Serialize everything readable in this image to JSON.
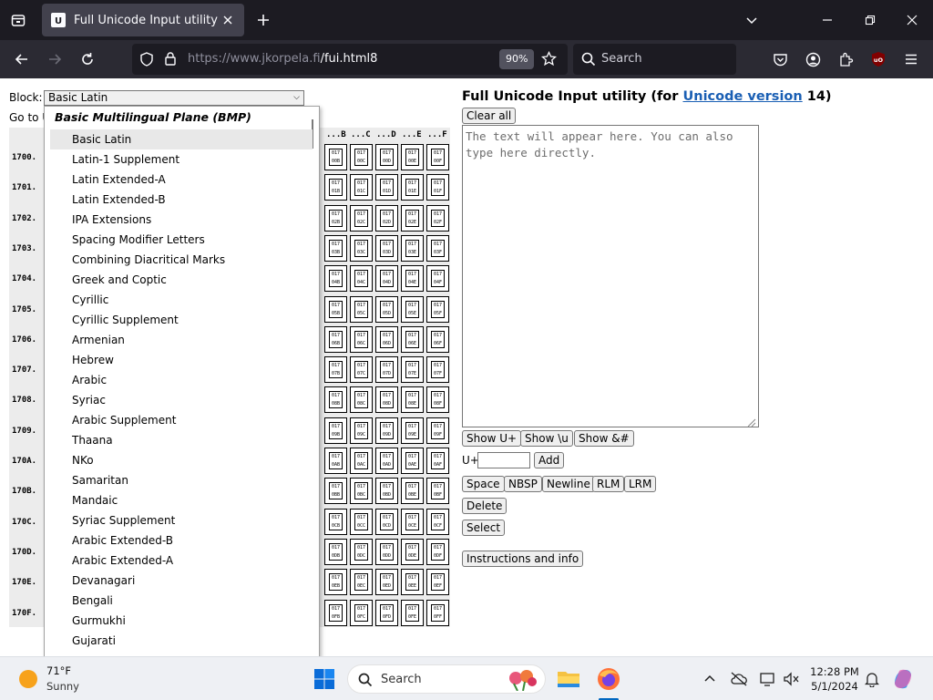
{
  "browser": {
    "tab_title": "Full Unicode Input utility",
    "url_host": "https://www.jkorpela.fi",
    "url_path": "/fui.html8",
    "zoom": "90%",
    "search_placeholder": "Search"
  },
  "page": {
    "block_label": "Block:",
    "block_selected": "Basic Latin",
    "goto_label": "Go to U",
    "heading_prefix": "Full Unicode Input utility (for ",
    "heading_link": "Unicode version",
    "heading_suffix": " 14)",
    "clear_all": "Clear all",
    "textarea_placeholder": "The text will appear here. You can also type here directly.",
    "buttons_row1": [
      "Show U+",
      "Show \\u",
      "Show &#"
    ],
    "u_plus_label": "U+",
    "add_label": "Add",
    "buttons_row2": [
      "Space",
      "NBSP",
      "Newline",
      "RLM",
      "LRM"
    ],
    "delete_label": "Delete",
    "select_label": "Select",
    "instructions_label": "Instructions and info"
  },
  "grid": {
    "col_headers": [
      "...B",
      "...C",
      "...D",
      "...E",
      "...F"
    ],
    "row_headers": [
      "1700.",
      "1701.",
      "1702.",
      "1703.",
      "1704.",
      "1705.",
      "1706.",
      "1707.",
      "1708.",
      "1709.",
      "170A.",
      "170B.",
      "170C.",
      "170D.",
      "170E.",
      "170F."
    ],
    "glyph_top": "017",
    "glyph_rows": [
      "0",
      "1",
      "2",
      "3",
      "4",
      "5",
      "6",
      "7",
      "8",
      "9",
      "A",
      "B",
      "C",
      "D",
      "E",
      "F"
    ],
    "glyph_cols": [
      "B",
      "C",
      "D",
      "E",
      "F"
    ]
  },
  "dropdown": {
    "group": "Basic Multilingual Plane (BMP)",
    "items": [
      "Basic Latin",
      "Latin-1 Supplement",
      "Latin Extended-A",
      "Latin Extended-B",
      "IPA Extensions",
      "Spacing Modifier Letters",
      "Combining Diacritical Marks",
      "Greek and Coptic",
      "Cyrillic",
      "Cyrillic Supplement",
      "Armenian",
      "Hebrew",
      "Arabic",
      "Syriac",
      "Arabic Supplement",
      "Thaana",
      "NKo",
      "Samaritan",
      "Mandaic",
      "Syriac Supplement",
      "Arabic Extended-B",
      "Arabic Extended-A",
      "Devanagari",
      "Bengali",
      "Gurmukhi",
      "Gujarati"
    ],
    "selected_index": 0
  },
  "taskbar": {
    "temperature": "71°F",
    "condition": "Sunny",
    "search_placeholder": "Search",
    "time": "12:28 PM",
    "date": "5/1/2024"
  },
  "colors": {
    "tabbar_bg": "#1c1b22",
    "navbar_bg": "#2b2a33",
    "link": "#1a5fb4",
    "taskbar_bg": "#eef0f4"
  }
}
